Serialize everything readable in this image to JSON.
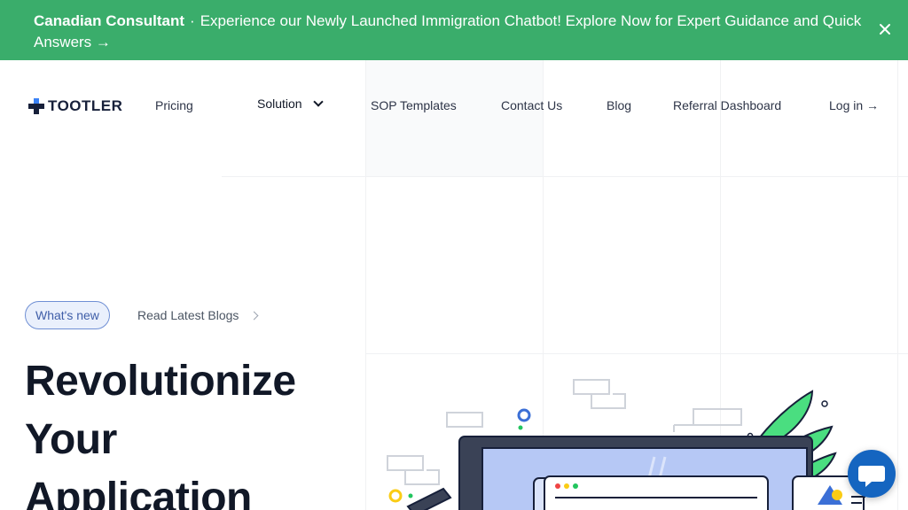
{
  "banner": {
    "brand": "Canadian Consultant",
    "separator": "·",
    "message": "Experience our Newly Launched Immigration Chatbot! Explore Now for Expert Guidance and Quick Answers →",
    "close_icon": "close-icon"
  },
  "nav": {
    "logo_text": "TOOTLER",
    "items": [
      {
        "label": "Pricing"
      },
      {
        "label": "Solution"
      },
      {
        "label": "SOP Templates"
      },
      {
        "label": "Contact Us"
      },
      {
        "label": "Blog"
      },
      {
        "label": "Referral Dashboard"
      },
      {
        "label": "Log in →"
      }
    ]
  },
  "hero": {
    "badge": "What's new",
    "blog_link": "Read Latest Blogs",
    "headline_lines": [
      "Revolutionize",
      "Your",
      "Application"
    ]
  },
  "colors": {
    "banner": "#3aad6b",
    "brand_navy": "#17203a",
    "accent_blue": "#3f5ea8",
    "chat_button": "#1565c0"
  },
  "icons": {
    "chat": "chat-bubble-icon",
    "dropdown": "chevron-down-icon",
    "blog_arrow": "chevron-right-icon"
  }
}
